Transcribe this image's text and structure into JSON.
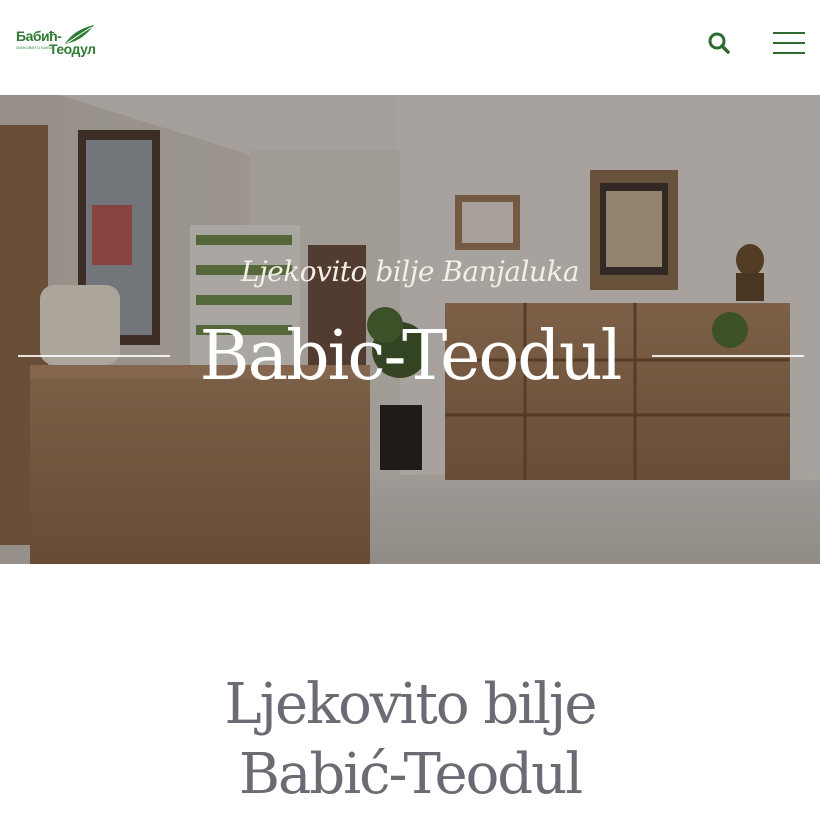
{
  "header": {
    "logo": {
      "line1": "Бабић-",
      "line2": "Теодул",
      "tagline": "ЉЕКОВИТО БИЉЕ"
    },
    "search_icon": "search-icon",
    "menu_icon": "hamburger-menu-icon"
  },
  "hero": {
    "subtitle": "Ljekovito bilje Banjaluka",
    "title": "Babic-Teodul"
  },
  "intro": {
    "title_line1": "Ljekovito bilje",
    "title_line2": "Babić-Teodul"
  },
  "colors": {
    "brand_green": "#2f7d32",
    "heading_gray": "#6b6b73"
  }
}
